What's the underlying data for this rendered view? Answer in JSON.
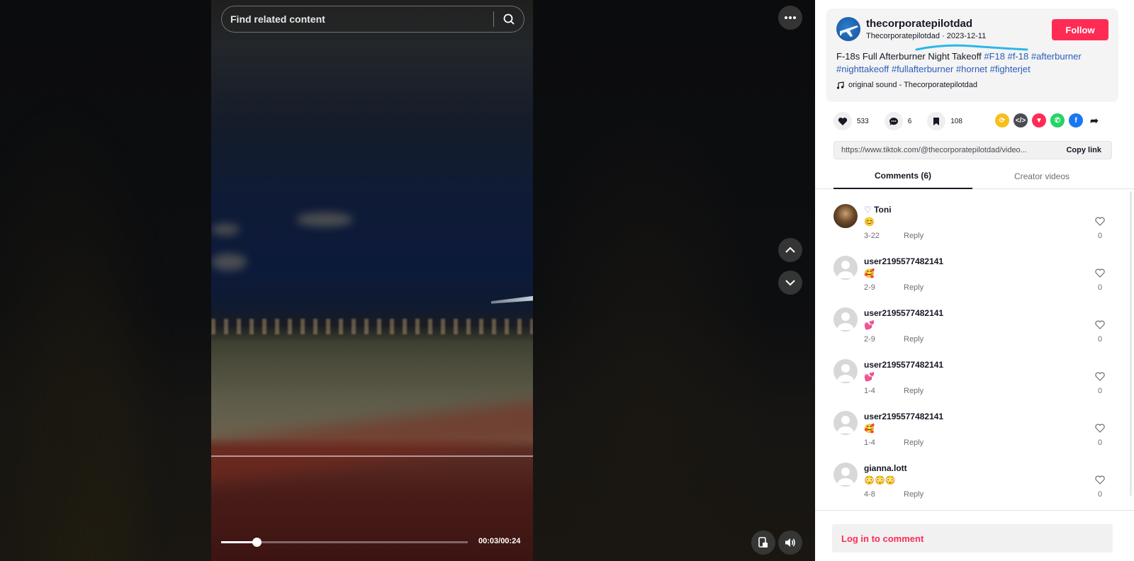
{
  "search": {
    "placeholder": "Find related content"
  },
  "player": {
    "current_time": "00:03",
    "duration": "00:24",
    "time_display": "00:03/00:24",
    "progress": 0.144
  },
  "creator": {
    "username": "thecorporatepilotdad",
    "display_name": "Thecorporatepilotdad",
    "date": "2023-12-11",
    "subline": "Thecorporatepilotdad · 2023-12-11",
    "follow_label": "Follow"
  },
  "post": {
    "caption": "F-18s Full Afterburner Night Takeoff",
    "hashtags": [
      "#F18",
      "#f-18",
      "#afterburner",
      "#nighttakeoff",
      "#fullafterburner",
      "#hornet",
      "#fighterjet"
    ],
    "sound": "original sound - Thecorporatepilotdad"
  },
  "stats": {
    "likes": "533",
    "comments": "6",
    "saves": "108"
  },
  "share_icons": [
    "repost-icon",
    "embed-icon",
    "send-icon",
    "whatsapp-icon",
    "facebook-icon",
    "share-arrow-icon"
  ],
  "link": {
    "url": "https://www.tiktok.com/@thecorporatepilotdad/video...",
    "copy_label": "Copy link"
  },
  "tabs": [
    {
      "label": "Comments (6)",
      "active": true
    },
    {
      "label": "Creator videos",
      "active": false
    }
  ],
  "comments": [
    {
      "name": "Toni",
      "emoji": "😊",
      "date": "3-22",
      "reply": "Reply",
      "likes": "0"
    },
    {
      "name": "user2195577482141",
      "emoji": "🥰",
      "date": "2-9",
      "reply": "Reply",
      "likes": "0"
    },
    {
      "name": "user2195577482141",
      "emoji": "💕",
      "date": "2-9",
      "reply": "Reply",
      "likes": "0"
    },
    {
      "name": "user2195577482141",
      "emoji": "💕",
      "date": "1-4",
      "reply": "Reply",
      "likes": "0"
    },
    {
      "name": "user2195577482141",
      "emoji": "🥰",
      "date": "1-4",
      "reply": "Reply",
      "likes": "0"
    },
    {
      "name": "gianna.lott",
      "emoji": "😳😳😳",
      "date": "4-8",
      "reply": "Reply",
      "likes": "0"
    }
  ],
  "login_prompt": "Log in to comment",
  "colors": {
    "accent": "#fe2c55",
    "hashtag": "#2b5db9",
    "text": "#161823"
  }
}
